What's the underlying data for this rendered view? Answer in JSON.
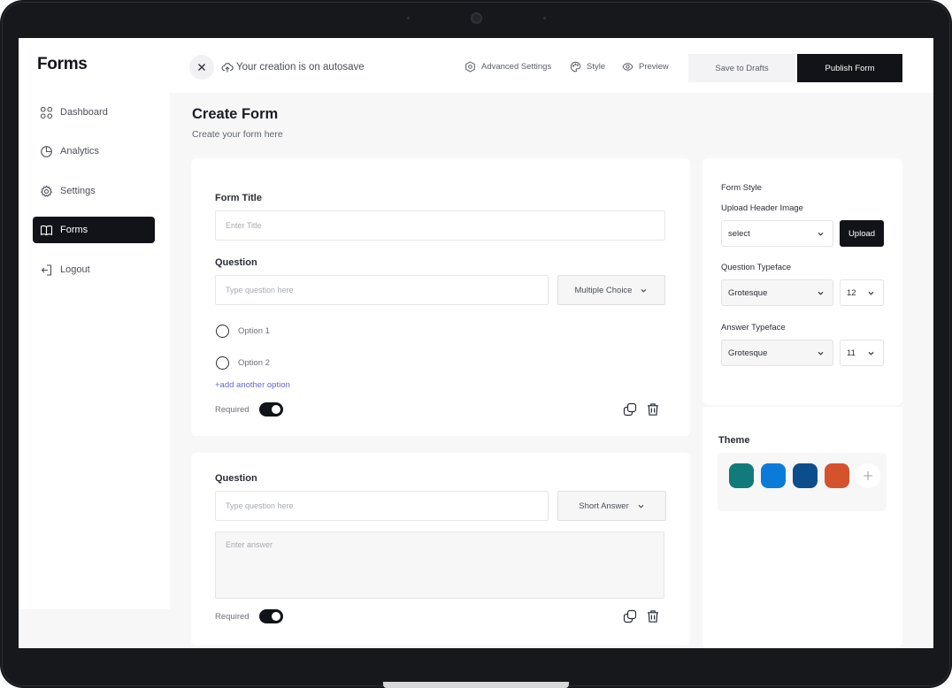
{
  "app": {
    "brand": "Forms"
  },
  "sidebar": {
    "items": [
      {
        "label": "Dashboard",
        "icon": "grid-icon"
      },
      {
        "label": "Analytics",
        "icon": "pie-chart-icon"
      },
      {
        "label": "Settings",
        "icon": "gear-icon"
      },
      {
        "label": "Forms",
        "icon": "book-icon",
        "active": true
      },
      {
        "label": "Logout",
        "icon": "logout-icon"
      }
    ]
  },
  "topbar": {
    "autosave": "Your creation is on autosave",
    "advanced_settings": "Advanced Settings",
    "style": "Style",
    "preview": "Preview",
    "save_drafts": "Save to Drafts",
    "publish": "Publish Form"
  },
  "page": {
    "title": "Create Form",
    "subtitle": "Create your form here"
  },
  "card1": {
    "form_title_label": "Form Title",
    "form_title_placeholder": "Enter Title",
    "question_label": "Question",
    "question_placeholder": "Type question here",
    "type": "Multiple Choice",
    "options": [
      "Option 1",
      "Option 2"
    ],
    "add_option": "+add another option",
    "required_label": "Required"
  },
  "card2": {
    "question_label": "Question",
    "question_placeholder": "Type question here",
    "type": "Short Answer",
    "answer_placeholder": "Enter answer",
    "required_label": "Required"
  },
  "style_panel": {
    "heading": "Form Style",
    "upload_label": "Upload Header Image",
    "upload_select": "select",
    "upload_button": "Upload",
    "question_typeface_label": "Question Typeface",
    "question_font": "Grotesque",
    "question_size": "12",
    "answer_typeface_label": "Answer Typeface",
    "answer_font": "Grotesque",
    "answer_size": "11",
    "theme_label": "Theme",
    "theme_colors": [
      "#117a7a",
      "#0a7bd8",
      "#0c4d8c",
      "#d4532c"
    ]
  }
}
